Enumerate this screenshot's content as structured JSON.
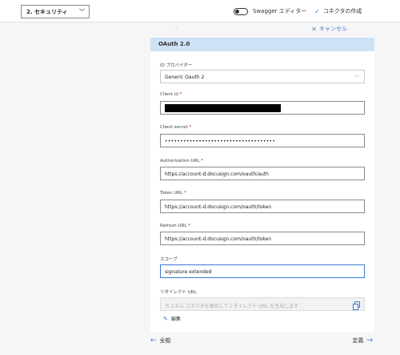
{
  "topbar": {
    "step": "2. セキュリティ",
    "swagger_label": "Swagger エディター",
    "create_label": "コネクタの作成"
  },
  "cancel_label": "キャンセル",
  "panel": {
    "title": "OAuth 2.0",
    "idp": {
      "label": "ID プロバイダー",
      "value": "Generic Oauth 2"
    },
    "client_id": {
      "label": "Client id",
      "value": ""
    },
    "client_secret": {
      "label": "Client secret",
      "value": "••••••••••••••••••••••••••••••••••••"
    },
    "auth_url": {
      "label": "Authorization URL",
      "value": "https://account-d.docusign.com/oauth/auth"
    },
    "token_url": {
      "label": "Token URL",
      "value": "https://account-d.docusign.com/oauth/token"
    },
    "refresh_url": {
      "label": "Refresh URL",
      "value": "https://account-d.docusign.com/oauth/token"
    },
    "scope": {
      "label": "スコープ",
      "value": "signature extended"
    },
    "redirect": {
      "label": "リダイレクト URL",
      "placeholder": "カスタム コネクタを保存してリダイレクト URL を生成します"
    },
    "edit_label": "編集"
  },
  "footer": {
    "back_label": "全般",
    "next_label": "定義"
  }
}
